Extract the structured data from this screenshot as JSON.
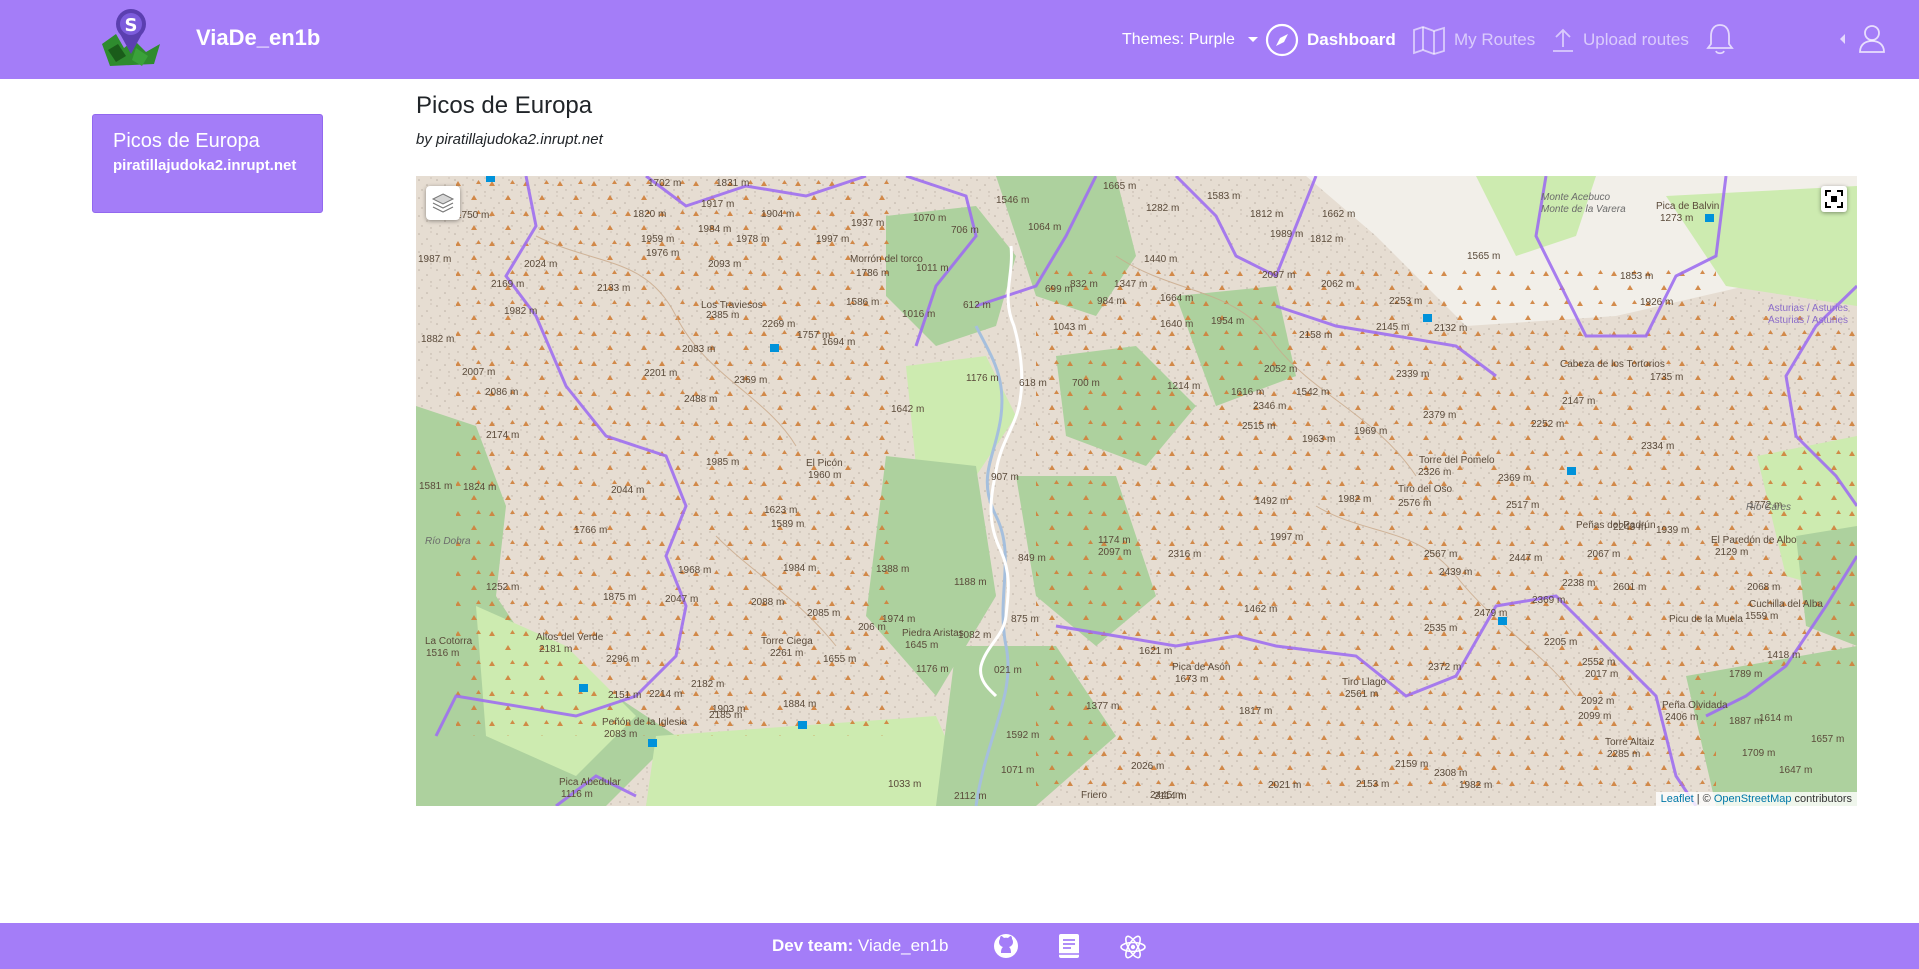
{
  "app": {
    "brand": "ViaDe_en1b"
  },
  "nav": {
    "theme_label": "Themes: Purple",
    "dashboard": "Dashboard",
    "my_routes": "My Routes",
    "upload_routes": "Upload routes"
  },
  "sidebar": {
    "routes": [
      {
        "name": "Picos de Europa",
        "author": "piratillajudoka2.inrupt.net"
      }
    ]
  },
  "route": {
    "title": "Picos de Europa",
    "byline": "by piratillajudoka2.inrupt.net"
  },
  "map": {
    "attribution_leaflet": "Leaflet",
    "attribution_sep": " | © ",
    "attribution_osm": "OpenStreetMap",
    "attribution_tail": " contributors",
    "labels": [
      "1702 m",
      "1831 m",
      "1820 m",
      "1917 m",
      "1904 m",
      "1937 m",
      "1070 m",
      "1546 m",
      "1665 m",
      "1583 m",
      "1282 m",
      "1812 m",
      "1662 m",
      "1750 m",
      "1984 m",
      "1959 m",
      "1978 m",
      "1997 m",
      "706 m",
      "1064 m",
      "1989 m",
      "1987 m",
      "1976 m",
      "2024 m",
      "2093 m",
      "Morrón del torco",
      "1786 m",
      "1011 m",
      "1440 m",
      "1812 m",
      "1565 m",
      "1853 m",
      "2169 m",
      "2133 m",
      "Los Traviesos",
      "2385 m",
      "1586 m",
      "1016 m",
      "612 m",
      "699 m",
      "832 m",
      "1347 m",
      "984 m",
      "1664 m",
      "2097 m",
      "2062 m",
      "2253 m",
      "1926 m",
      "1982 m",
      "2269 m",
      "1757 m",
      "1043 m",
      "1640 m",
      "1954 m",
      "2158 m",
      "2145 m",
      "2132 m",
      "1882 m",
      "2083 m",
      "1694 m",
      "618 m",
      "2052 m",
      "2339 m",
      "Cabeza de los Tortorios",
      "2147 m",
      "1735 m",
      "2007 m",
      "2201 m",
      "2369 m",
      "1176 m",
      "700 m",
      "1214 m",
      "1616 m",
      "1542 m",
      "2346 m",
      "2086 m",
      "2488 m",
      "2379 m",
      "2252 m",
      "2515 m",
      "1642 m",
      "1963 m",
      "1969 m",
      "2334 m",
      "2174 m",
      "1985 m",
      "El Picón",
      "1960 m",
      "907 m",
      "Torre del Pomelo",
      "2326 m",
      "2369 m",
      "1581 m",
      "1824 m",
      "2044 m",
      "1492 m",
      "1982 m",
      "Tiro del Oso",
      "2576 m",
      "2517 m",
      "1772 m",
      "1623 m",
      "1766 m",
      "1589 m",
      "1939 m",
      "2243 m",
      "Peñas del Padrún",
      "1174 m",
      "2097 m",
      "2316 m",
      "1997 m",
      "El Paredón de Albo",
      "2129 m",
      "849 m",
      "2567 m",
      "2447 m",
      "2067 m",
      "1968 m",
      "1984 m",
      "1388 m",
      "2439 m",
      "1252 m",
      "1188 m",
      "2238 m",
      "2601 m",
      "2068 m",
      "1875 m",
      "2047 m",
      "2088 m",
      "2369 m",
      "1462 m",
      "2479 m",
      "Cuchilla del Alba",
      "1559 m",
      "2085 m",
      "1974 m",
      "875 m",
      "Picu de la Muela",
      "La Cotorra",
      "1516 m",
      "Altos del Verde",
      "2181 m",
      "Torre Ciega",
      "2261 m",
      "206 m",
      "Piedra Aristas",
      "1645 m",
      "1082 m",
      "2535 m",
      "2205 m",
      "1418 m",
      "2296 m",
      "1655 m",
      "1621 m",
      "2372 m",
      "2552 m",
      "1789 m",
      "2151 m",
      "2182 m",
      "1176 m",
      "021 m",
      "Pica de Asón",
      "1673 m",
      "2017 m",
      "Tiro Llago",
      "2561 m",
      "2214 m",
      "1903 m",
      "1884 m",
      "1377 m",
      "1817 m",
      "2092 m",
      "2099 m",
      "Peña Olvidada",
      "2406 m",
      "1887 m",
      "1614 m",
      "Peñón de la Iglesia",
      "2083 m",
      "2185 m",
      "1657 m",
      "1592 m",
      "Torre Altaiz",
      "2285 m",
      "1709 m",
      "1647 m",
      "1033 m",
      "1071 m",
      "2026 m",
      "2159 m",
      "2308 m",
      "Pica Abedular",
      "1116 m",
      "2112 m",
      "Friero",
      "2445 m",
      "2114 m",
      "2021 m",
      "2153 m",
      "1982 m",
      "Monte Acebuco",
      "Monte de la Varera",
      "Pica de Balvin",
      "1273 m",
      "Asturias / Asturies",
      "Asturias / Asturies",
      "Río Cares",
      "Río Dobra"
    ]
  },
  "footer": {
    "team_label": "Dev team:",
    "team_value": " Viade_en1b"
  },
  "colors": {
    "primary": "#a47df8",
    "route_line": "#ffffff",
    "boundary": "#9e6ff0",
    "forest": "#add19e"
  }
}
